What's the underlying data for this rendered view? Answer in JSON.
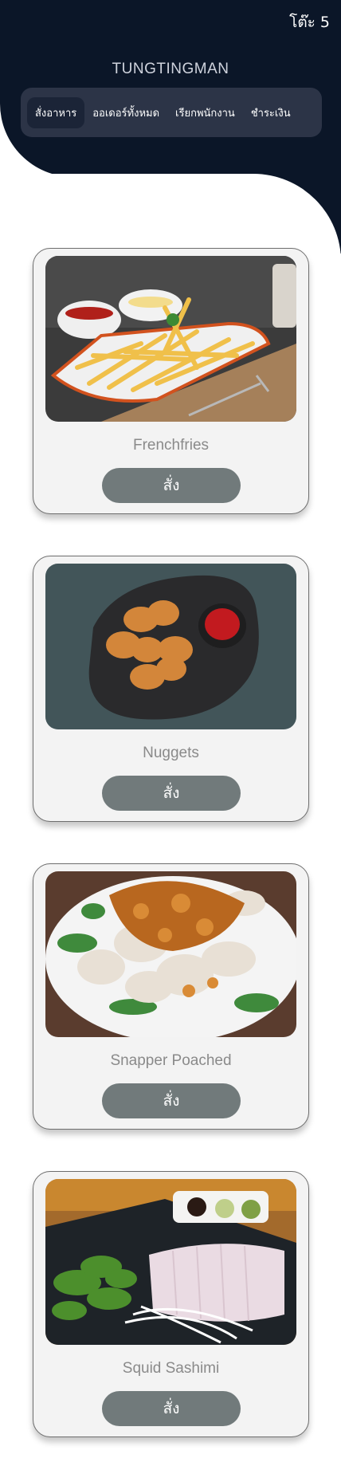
{
  "header": {
    "table_label": "โต๊ะ 5",
    "brand": "TUNGTINGMAN"
  },
  "nav": {
    "items": [
      {
        "label": "สั่งอาหาร",
        "active": true
      },
      {
        "label": "ออเดอร์ทั้งหมด",
        "active": false
      },
      {
        "label": "เรียกพนักงาน",
        "active": false
      },
      {
        "label": "ชำระเงิน",
        "active": false
      }
    ]
  },
  "menu": {
    "order_label": "สั่ง",
    "items": [
      {
        "name": "Frenchfries",
        "image": "frenchfries-photo"
      },
      {
        "name": "Nuggets",
        "image": "nuggets-photo"
      },
      {
        "name": "Snapper Poached",
        "image": "snapper-photo"
      },
      {
        "name": "Squid Sashimi",
        "image": "squid-sashimi-photo"
      }
    ]
  },
  "colors": {
    "header_bg": "#0b1628",
    "nav_bg": "#2c3447",
    "nav_active": "#1b2437",
    "card_bg": "#f3f3f3",
    "button_bg": "#717a7b"
  }
}
